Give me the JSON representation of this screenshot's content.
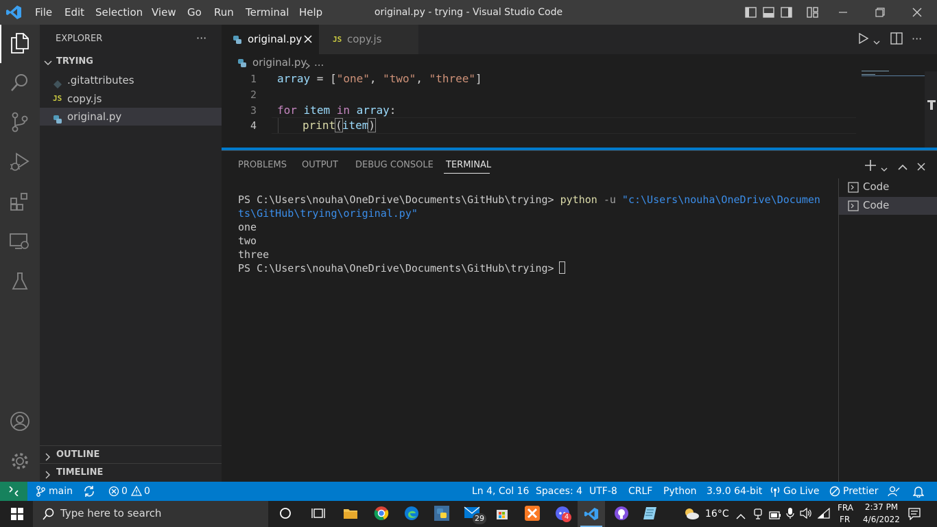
{
  "titlebar": {
    "menu": [
      "File",
      "Edit",
      "Selection",
      "View",
      "Go",
      "Run",
      "Terminal",
      "Help"
    ],
    "window_title": "original.py - trying - Visual Studio Code"
  },
  "sidebar": {
    "header": "EXPLORER",
    "more": "···",
    "folder": "TRYING",
    "files": [
      {
        "name": ".gitattributes",
        "icon": "gear-file-icon"
      },
      {
        "name": "copy.js",
        "icon": "JS"
      },
      {
        "name": "original.py",
        "icon": "python-icon"
      }
    ],
    "outline": "OUTLINE",
    "timeline": "TIMELINE"
  },
  "editor": {
    "tabs": [
      {
        "label": "original.py",
        "active": true
      },
      {
        "label": "copy.js",
        "active": false
      }
    ],
    "js_badge": "JS",
    "breadcrumb": {
      "file": "original.py",
      "more": "..."
    },
    "line_numbers": [
      "1",
      "2",
      "3",
      "4"
    ],
    "code": {
      "l1": {
        "var": "array",
        "eq": " = [",
        "s1": "\"one\"",
        "c1": ", ",
        "s2": "\"two\"",
        "c2": ", ",
        "s3": "\"three\"",
        "end": "]"
      },
      "l3": {
        "kw_for": "for",
        "item": "item",
        "kw_in": "in",
        "arr": "array",
        "colon": ":"
      },
      "l4": {
        "fn": "print",
        "open": "(",
        "arg": "item",
        "close": ")"
      }
    }
  },
  "panel": {
    "tabs": [
      "PROBLEMS",
      "OUTPUT",
      "DEBUG CONSOLE",
      "TERMINAL"
    ],
    "active_tab": "TERMINAL",
    "terminal": {
      "prompt": "PS C:\\Users\\nouha\\OneDrive\\Documents\\GitHub\\trying> ",
      "cmd": "python",
      "flag": " -u ",
      "path_part1": "\"c:\\Users\\nouha\\OneDrive\\Documen",
      "path_part2": "ts\\GitHub\\trying\\original.py\"",
      "output": [
        "one",
        "two",
        "three"
      ],
      "prompt2": "PS C:\\Users\\nouha\\OneDrive\\Documents\\GitHub\\trying> "
    },
    "terminals": [
      "Code",
      "Code"
    ]
  },
  "statusbar": {
    "branch": "main",
    "errors": "0",
    "warnings": "0",
    "position": "Ln 4, Col 16",
    "spaces": "Spaces: 4",
    "encoding": "UTF-8",
    "eol": "CRLF",
    "language": "Python",
    "interpreter": "3.9.0 64-bit",
    "golive": "Go Live",
    "prettier": "Prettier"
  },
  "taskbar": {
    "search_placeholder": "Type here to search",
    "mail_badge": "29",
    "discord_badge": "4",
    "weather": "16°C",
    "lang_top": "FRA",
    "lang_bottom": "FR",
    "time": "2:37 PM",
    "date": "4/6/2022"
  },
  "colors": {
    "accent": "#007acc",
    "keyword": "#c586c0",
    "variable": "#9cdcfe",
    "string": "#ce9178",
    "function": "#dcdcaa",
    "cmd_yellow": "#dcdcaa",
    "path_blue": "#3b8eea"
  }
}
